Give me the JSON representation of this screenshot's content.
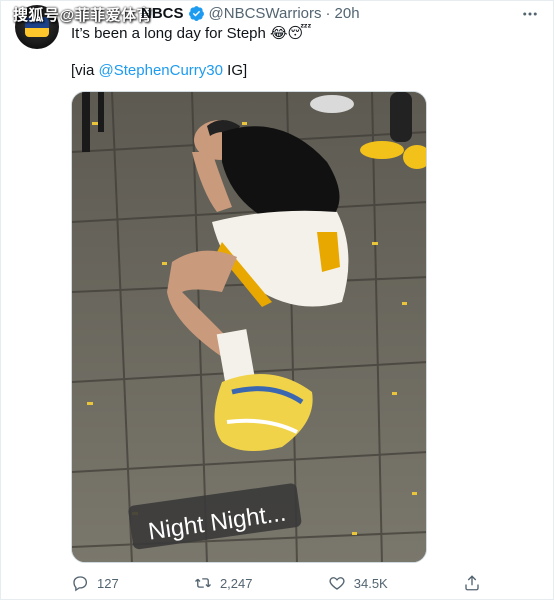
{
  "watermark": "搜狐号@菲菲爱体育",
  "tweet": {
    "author_name": "NBCS",
    "handle": "@NBCSWarriors",
    "separator": "·",
    "timestamp": "20h",
    "text": "It’s been a long day for Steph 😂😴",
    "via_prefix": "[via ",
    "via_mention": "@StephenCurry30",
    "via_suffix": " IG]",
    "photo_caption": "Night Night..."
  },
  "actions": {
    "replies": "127",
    "retweets": "2,247",
    "likes": "34.5K"
  },
  "colors": {
    "accent": "#1d9bf0",
    "muted": "#536471",
    "text": "#0f1419"
  }
}
